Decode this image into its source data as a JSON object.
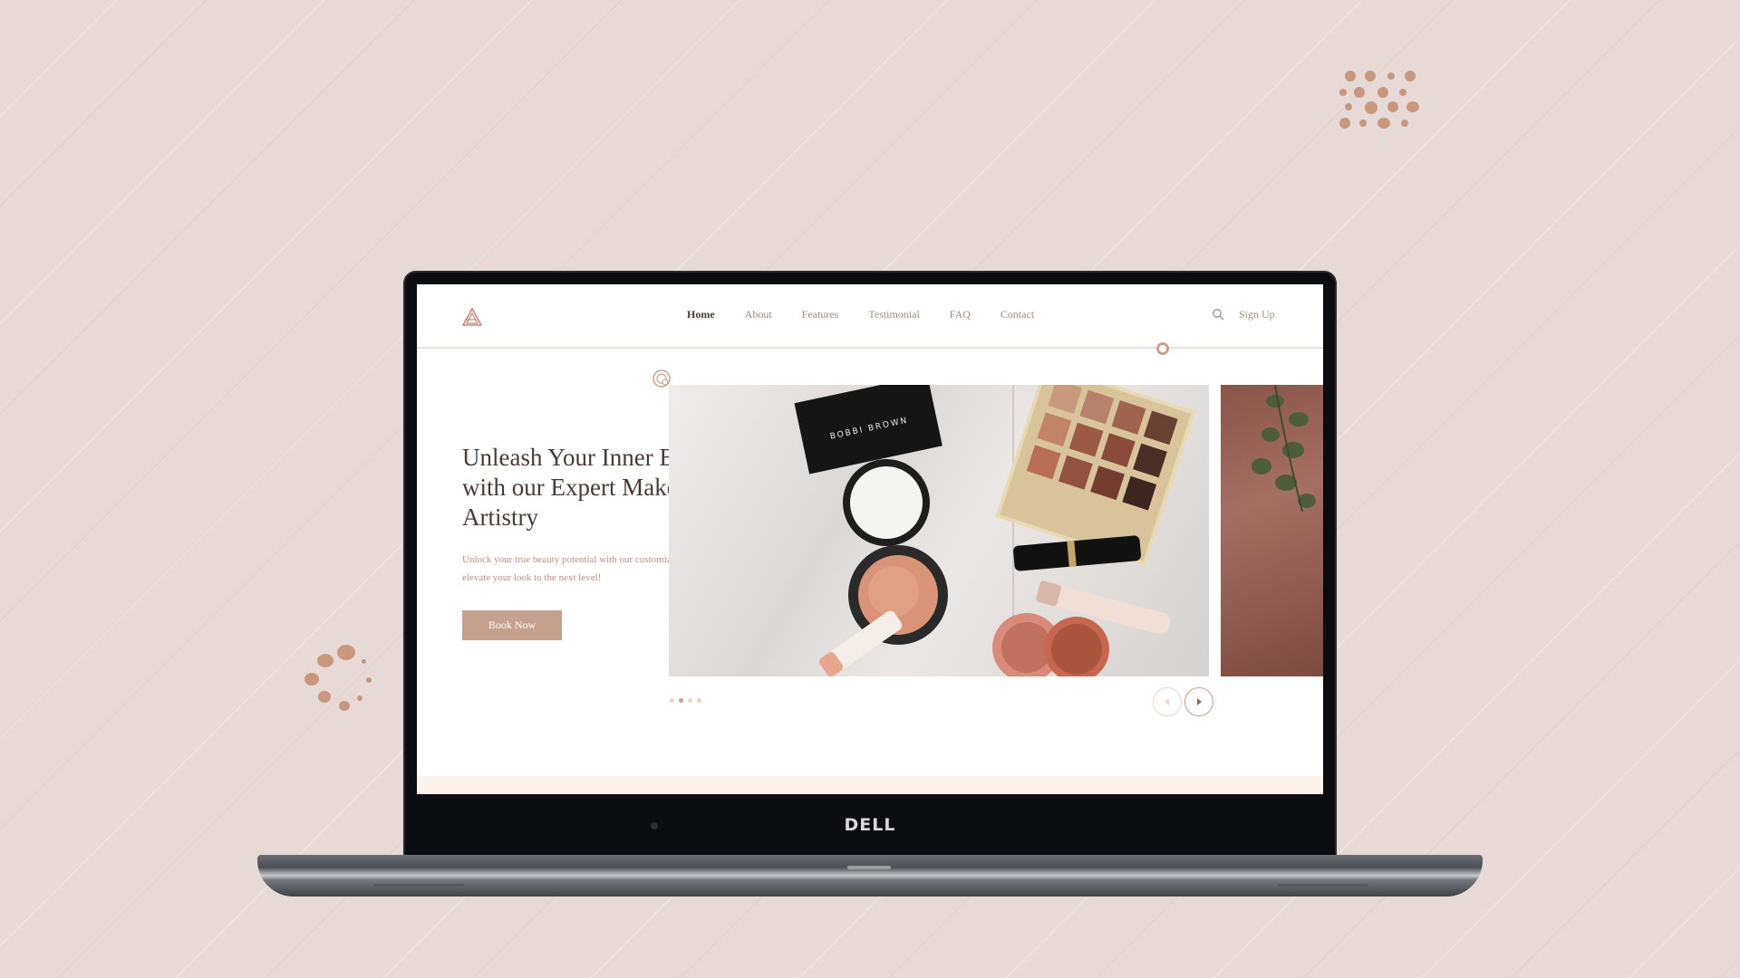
{
  "site": {
    "nav": {
      "items": [
        {
          "label": "Home",
          "active": true
        },
        {
          "label": "About",
          "active": false
        },
        {
          "label": "Features",
          "active": false
        },
        {
          "label": "Testimonial",
          "active": false
        },
        {
          "label": "FAQ",
          "active": false
        },
        {
          "label": "Contact",
          "active": false
        }
      ],
      "signup_label": "Sign Up"
    },
    "hero": {
      "title": "Unleash Your Inner Beauty with our Expert Makeup Artistry",
      "subtitle": "Unlock your true beauty potential with our customized makeup artistry and elevate your look to the next level!",
      "cta_label": "Book Now"
    },
    "carousel": {
      "slide_count": 4,
      "active_index": 1,
      "product_brand": "BOBBI BROWN"
    }
  },
  "device": {
    "brand": "DELL"
  },
  "colors": {
    "accent": "#c4a08d",
    "heading": "#4a3a34",
    "nav_text": "#a48b80",
    "background": "#e7dad6",
    "decor_dots": "#c9977e"
  },
  "icons": [
    "logo-mark-icon",
    "search-icon",
    "camera-lens-icon",
    "chevron-left-icon",
    "chevron-right-icon"
  ]
}
